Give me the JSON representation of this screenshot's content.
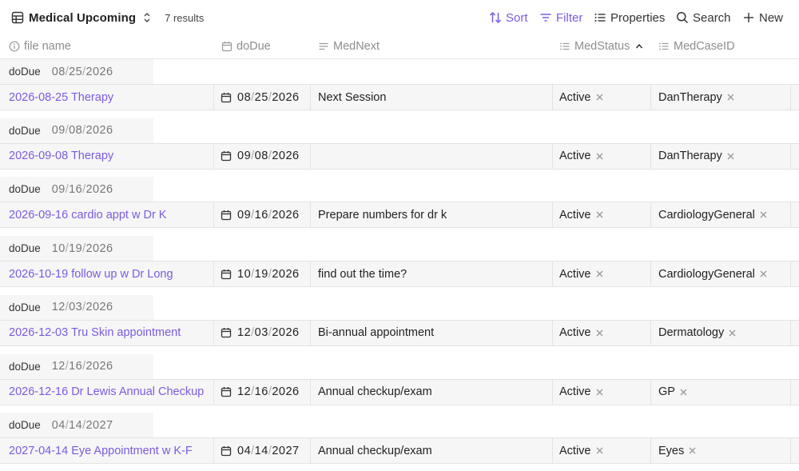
{
  "toolbar": {
    "view_title": "Medical Upcoming",
    "result_count": "7 results",
    "view_icon": "table-icon",
    "switch_icon": "chevron-up-down-icon",
    "buttons": {
      "sort": "Sort",
      "filter": "Filter",
      "properties": "Properties",
      "search": "Search",
      "new": "New"
    }
  },
  "columns": [
    {
      "key": "file",
      "label": "file name",
      "icon": "info-icon"
    },
    {
      "key": "doDue",
      "label": "doDue",
      "icon": "calendar-icon"
    },
    {
      "key": "MedNext",
      "label": "MedNext",
      "icon": "text-lines-icon"
    },
    {
      "key": "MedStatus",
      "label": "MedStatus",
      "icon": "list-icon",
      "sorted": "ascending"
    },
    {
      "key": "MedCaseID",
      "label": "MedCaseID",
      "icon": "list-icon"
    }
  ],
  "group_key": "doDue",
  "accent_color": "#7b5be0",
  "groups": [
    {
      "mm": "08",
      "dd": "25",
      "yyyy": "2026",
      "row": {
        "file": "2026-08-25 Therapy",
        "next": "Next Session",
        "status": "Active",
        "case": "DanTherapy"
      }
    },
    {
      "mm": "09",
      "dd": "08",
      "yyyy": "2026",
      "row": {
        "file": "2026-09-08 Therapy",
        "next": "",
        "status": "Active",
        "case": "DanTherapy"
      }
    },
    {
      "mm": "09",
      "dd": "16",
      "yyyy": "2026",
      "row": {
        "file": "2026-09-16 cardio appt w Dr K",
        "next": "Prepare numbers for dr k",
        "status": "Active",
        "case": "CardiologyGeneral"
      }
    },
    {
      "mm": "10",
      "dd": "19",
      "yyyy": "2026",
      "row": {
        "file": "2026-10-19 follow up w Dr Long",
        "next": "find out the time?",
        "status": "Active",
        "case": "CardiologyGeneral"
      }
    },
    {
      "mm": "12",
      "dd": "03",
      "yyyy": "2026",
      "row": {
        "file": "2026-12-03 Tru Skin appointment",
        "next": "Bi-annual appointment",
        "status": "Active",
        "case": "Dermatology"
      }
    },
    {
      "mm": "12",
      "dd": "16",
      "yyyy": "2026",
      "row": {
        "file": "2026-12-16 Dr Lewis Annual Checkup",
        "next": "Annual checkup/exam",
        "status": "Active",
        "case": "GP"
      }
    },
    {
      "mm": "04",
      "dd": "14",
      "yyyy": "2027",
      "row": {
        "file": "2027-04-14 Eye Appointment w K-F",
        "next": "Annual checkup/exam",
        "status": "Active",
        "case": "Eyes"
      }
    }
  ]
}
